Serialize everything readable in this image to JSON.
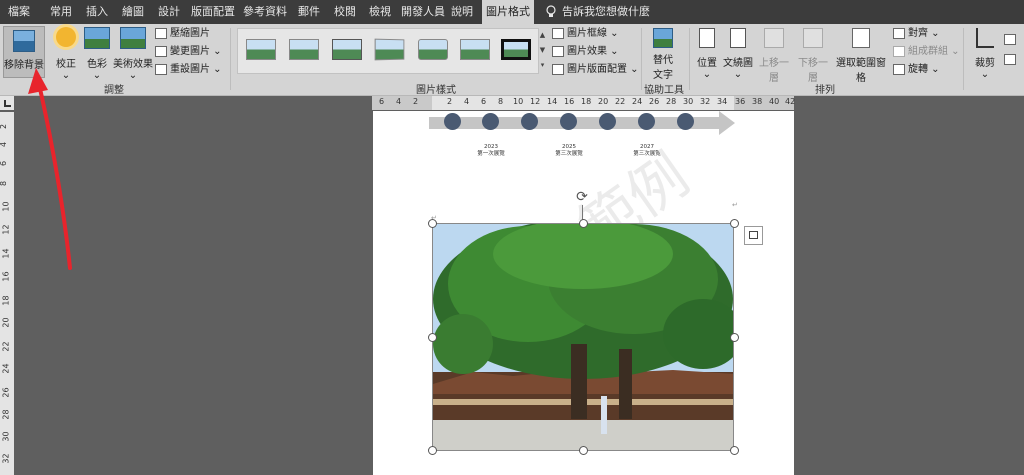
{
  "tabs": [
    "檔案",
    "常用",
    "插入",
    "繪圖",
    "設計",
    "版面配置",
    "參考資料",
    "郵件",
    "校閱",
    "檢視",
    "開發人員",
    "說明",
    "圖片格式"
  ],
  "tell_me": "告訴我您想做什麼",
  "ribbon": {
    "remove_bg": "移除背景",
    "corrections": "校正",
    "color": "色彩",
    "artistic": "美術效果",
    "compress": "壓縮圖片",
    "change_pic": "變更圖片",
    "reset_pic": "重設圖片",
    "adjust_label": "調整",
    "styles_label": "圖片樣式",
    "border": "圖片框線",
    "effects": "圖片效果",
    "layout": "圖片版面配置",
    "alt_text_1": "替代",
    "alt_text_2": "文字",
    "access_label": "協助工具",
    "position": "位置",
    "wrap": "文繞圖",
    "forward": "上移一層",
    "backward": "下移一層",
    "selection": "選取範圍窗格",
    "align": "對齊",
    "group": "組成群組",
    "rotate": "旋轉",
    "arrange_label": "排列",
    "crop": "裁剪"
  },
  "hruler": [
    "6",
    "4",
    "2",
    "2",
    "4",
    "6",
    "8",
    "10",
    "12",
    "14",
    "16",
    "18",
    "20",
    "22",
    "24",
    "26",
    "28",
    "30",
    "32",
    "34",
    "36",
    "38",
    "40",
    "42"
  ],
  "vruler": [
    "2",
    "4",
    "6",
    "8",
    "10",
    "12",
    "14",
    "16",
    "18",
    "20",
    "22",
    "24",
    "26",
    "28",
    "30",
    "32"
  ],
  "timeline": {
    "items": [
      {
        "year": "2023",
        "label": "第一次展覽"
      },
      {
        "year": "2025",
        "label": "第三次展覽"
      },
      {
        "year": "2027",
        "label": "第三次展覽"
      }
    ],
    "watermark": "範例"
  },
  "colors": {
    "accent": "#4a5a72",
    "ribbon": "#d4d4d4",
    "tabbar": "#3c3c3c",
    "bg": "#5f5f5f",
    "arrow": "#e8242c"
  }
}
